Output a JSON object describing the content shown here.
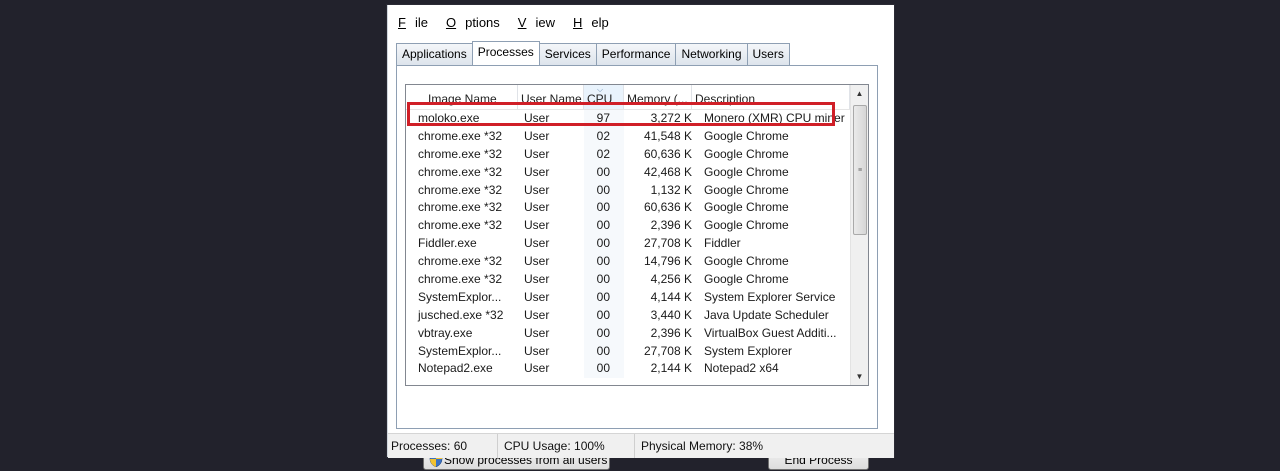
{
  "menu": [
    {
      "underline": "F",
      "rest": "ile"
    },
    {
      "underline": "O",
      "rest": "ptions"
    },
    {
      "underline": "V",
      "rest": "iew"
    },
    {
      "underline": "H",
      "rest": "elp"
    }
  ],
  "tabs": [
    "Applications",
    "Processes",
    "Services",
    "Performance",
    "Networking",
    "Users"
  ],
  "active_tab": "Processes",
  "columns": {
    "name": "Image Name",
    "user": "User Name",
    "cpu": "CPU",
    "memory": "Memory (...",
    "description": "Description"
  },
  "rows": [
    {
      "name": "moloko.exe",
      "user": "User",
      "cpu": "97",
      "memory": "3,272 K",
      "description": "Monero (XMR) CPU miner"
    },
    {
      "name": "chrome.exe *32",
      "user": "User",
      "cpu": "02",
      "memory": "41,548 K",
      "description": "Google Chrome"
    },
    {
      "name": "chrome.exe *32",
      "user": "User",
      "cpu": "02",
      "memory": "60,636 K",
      "description": "Google Chrome"
    },
    {
      "name": "chrome.exe *32",
      "user": "User",
      "cpu": "00",
      "memory": "42,468 K",
      "description": "Google Chrome"
    },
    {
      "name": "chrome.exe *32",
      "user": "User",
      "cpu": "00",
      "memory": "1,132 K",
      "description": "Google Chrome"
    },
    {
      "name": "chrome.exe *32",
      "user": "User",
      "cpu": "00",
      "memory": "60,636 K",
      "description": "Google Chrome"
    },
    {
      "name": "chrome.exe *32",
      "user": "User",
      "cpu": "00",
      "memory": "2,396 K",
      "description": "Google Chrome"
    },
    {
      "name": "Fiddler.exe",
      "user": "User",
      "cpu": "00",
      "memory": "27,708 K",
      "description": "Fiddler"
    },
    {
      "name": "chrome.exe *32",
      "user": "User",
      "cpu": "00",
      "memory": "14,796 K",
      "description": "Google Chrome"
    },
    {
      "name": "chrome.exe *32",
      "user": "User",
      "cpu": "00",
      "memory": "4,256 K",
      "description": "Google Chrome"
    },
    {
      "name": "SystemExplor...",
      "user": "User",
      "cpu": "00",
      "memory": "4,144 K",
      "description": "System Explorer Service"
    },
    {
      "name": "jusched.exe *32",
      "user": "User",
      "cpu": "00",
      "memory": "3,440 K",
      "description": "Java Update Scheduler"
    },
    {
      "name": "vbtray.exe",
      "user": "User",
      "cpu": "00",
      "memory": "2,396 K",
      "description": "VirtualBox Guest Additi..."
    },
    {
      "name": "SystemExplor...",
      "user": "User",
      "cpu": "00",
      "memory": "27,708 K",
      "description": "System Explorer"
    },
    {
      "name": "Notepad2.exe",
      "user": "User",
      "cpu": "00",
      "memory": "2,144 K",
      "description": "Notepad2 x64"
    }
  ],
  "buttons": {
    "show_all": "Show processes from all users",
    "end_process": "End Process"
  },
  "status": {
    "processes": "Processes: 60",
    "cpu": "CPU Usage: 100%",
    "memory": "Physical Memory: 38%"
  },
  "colors": {
    "highlight_box": "#d01f27",
    "background": "#22222c"
  }
}
